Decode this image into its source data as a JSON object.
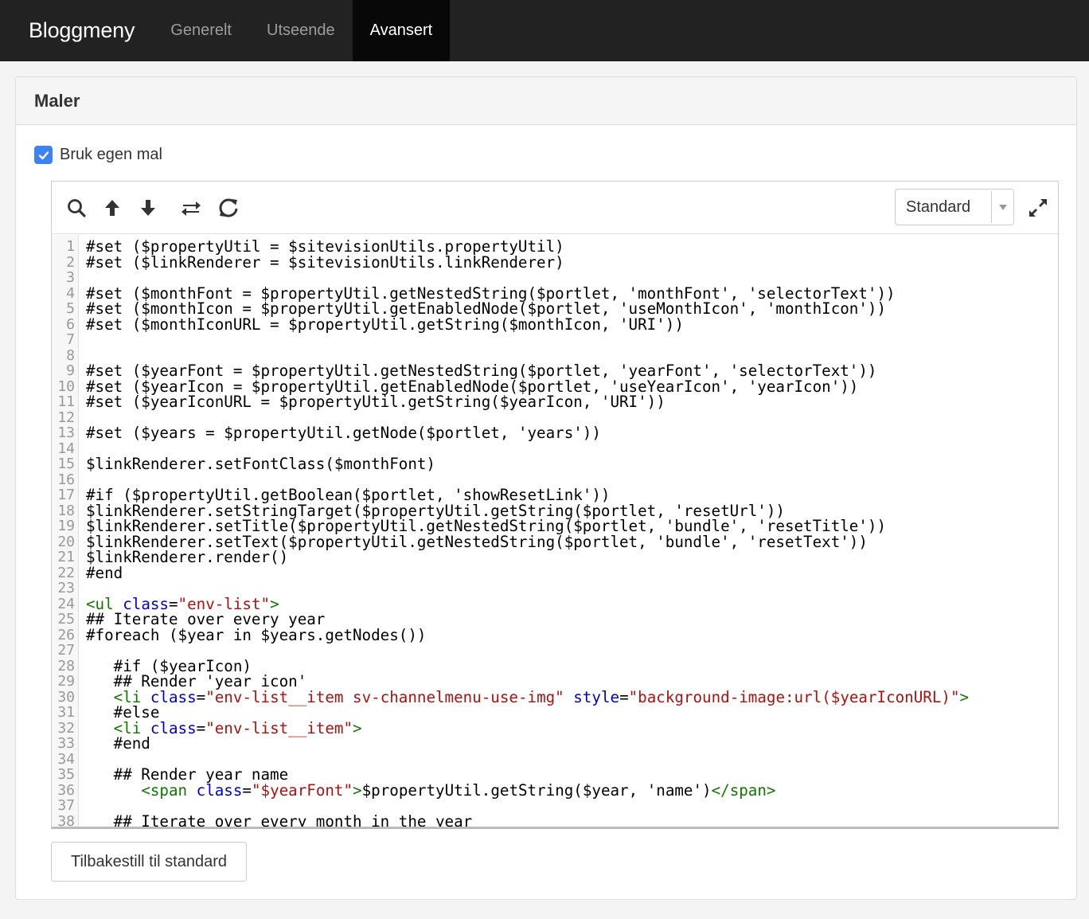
{
  "nav": {
    "brand": "Bloggmeny",
    "tabs": [
      {
        "label": "Generelt",
        "active": false
      },
      {
        "label": "Utseende",
        "active": false
      },
      {
        "label": "Avansert",
        "active": true
      }
    ]
  },
  "panel": {
    "title": "Maler",
    "checkbox_label": "Bruk egen mal",
    "checkbox_checked": true
  },
  "editor": {
    "toolbar_icons": [
      "search-icon",
      "arrow-up-icon",
      "arrow-down-icon",
      "swap-icon",
      "refresh-icon"
    ],
    "select_value": "Standard",
    "expand_icon": "expand-icon",
    "code_lines": [
      [
        {
          "t": "#set ($propertyUtil = $sitevisionUtils.propertyUtil)"
        }
      ],
      [
        {
          "t": "#set ($linkRenderer = $sitevisionUtils.linkRenderer)"
        }
      ],
      [],
      [
        {
          "t": "#set ($monthFont = $propertyUtil.getNestedString($portlet, 'monthFont', 'selectorText'))"
        }
      ],
      [
        {
          "t": "#set ($monthIcon = $propertyUtil.getEnabledNode($portlet, 'useMonthIcon', 'monthIcon'))"
        }
      ],
      [
        {
          "t": "#set ($monthIconURL = $propertyUtil.getString($monthIcon, 'URI'))"
        }
      ],
      [],
      [],
      [
        {
          "t": "#set ($yearFont = $propertyUtil.getNestedString($portlet, 'yearFont', 'selectorText'))"
        }
      ],
      [
        {
          "t": "#set ($yearIcon = $propertyUtil.getEnabledNode($portlet, 'useYearIcon', 'yearIcon'))"
        }
      ],
      [
        {
          "t": "#set ($yearIconURL = $propertyUtil.getString($yearIcon, 'URI'))"
        }
      ],
      [],
      [
        {
          "t": "#set ($years = $propertyUtil.getNode($portlet, 'years'))"
        }
      ],
      [],
      [
        {
          "t": "$linkRenderer.setFontClass($monthFont)"
        }
      ],
      [],
      [
        {
          "t": "#if ($propertyUtil.getBoolean($portlet, 'showResetLink'))"
        }
      ],
      [
        {
          "t": "$linkRenderer.setStringTarget($propertyUtil.getString($portlet, 'resetUrl'))"
        }
      ],
      [
        {
          "t": "$linkRenderer.setTitle($propertyUtil.getNestedString($portlet, 'bundle', 'resetTitle'))"
        }
      ],
      [
        {
          "t": "$linkRenderer.setText($propertyUtil.getNestedString($portlet, 'bundle', 'resetText'))"
        }
      ],
      [
        {
          "t": "$linkRenderer.render()"
        }
      ],
      [
        {
          "t": "#end"
        }
      ],
      [],
      [
        {
          "t": "<ul",
          "c": "tag"
        },
        {
          "t": " "
        },
        {
          "t": "class",
          "c": "attr"
        },
        {
          "t": "="
        },
        {
          "t": "\"env-list\"",
          "c": "str"
        },
        {
          "t": ">",
          "c": "tag"
        }
      ],
      [
        {
          "t": "## Iterate over every year"
        }
      ],
      [
        {
          "t": "#foreach ($year in $years.getNodes())"
        }
      ],
      [],
      [
        {
          "t": "   #if ($yearIcon)"
        }
      ],
      [
        {
          "t": "   ## Render 'year icon'"
        }
      ],
      [
        {
          "t": "   "
        },
        {
          "t": "<li",
          "c": "tag"
        },
        {
          "t": " "
        },
        {
          "t": "class",
          "c": "attr"
        },
        {
          "t": "="
        },
        {
          "t": "\"env-list__item sv-channelmenu-use-img\"",
          "c": "str"
        },
        {
          "t": " "
        },
        {
          "t": "style",
          "c": "attr"
        },
        {
          "t": "="
        },
        {
          "t": "\"background-image:url($yearIconURL)\"",
          "c": "str"
        },
        {
          "t": ">",
          "c": "tag"
        }
      ],
      [
        {
          "t": "   #else"
        }
      ],
      [
        {
          "t": "   "
        },
        {
          "t": "<li",
          "c": "tag"
        },
        {
          "t": " "
        },
        {
          "t": "class",
          "c": "attr"
        },
        {
          "t": "="
        },
        {
          "t": "\"env-list__item\"",
          "c": "str"
        },
        {
          "t": ">",
          "c": "tag"
        }
      ],
      [
        {
          "t": "   #end"
        }
      ],
      [],
      [
        {
          "t": "   ## Render year name"
        }
      ],
      [
        {
          "t": "      "
        },
        {
          "t": "<span",
          "c": "tag"
        },
        {
          "t": " "
        },
        {
          "t": "class",
          "c": "attr"
        },
        {
          "t": "="
        },
        {
          "t": "\"$yearFont\"",
          "c": "str"
        },
        {
          "t": ">",
          "c": "tag"
        },
        {
          "t": "$propertyUtil.getString($year, 'name')"
        },
        {
          "t": "</span>",
          "c": "tag"
        }
      ],
      [],
      [
        {
          "t": "   ## Iterate over every month in the year"
        }
      ]
    ]
  },
  "reset_button_label": "Tilbakestill til standard",
  "colors": {
    "topbar": "#222222",
    "active_tab": "#080808",
    "checkbox": "#3b82f6",
    "tag": "#117700",
    "attribute": "#0000cc",
    "string": "#aa1111"
  }
}
